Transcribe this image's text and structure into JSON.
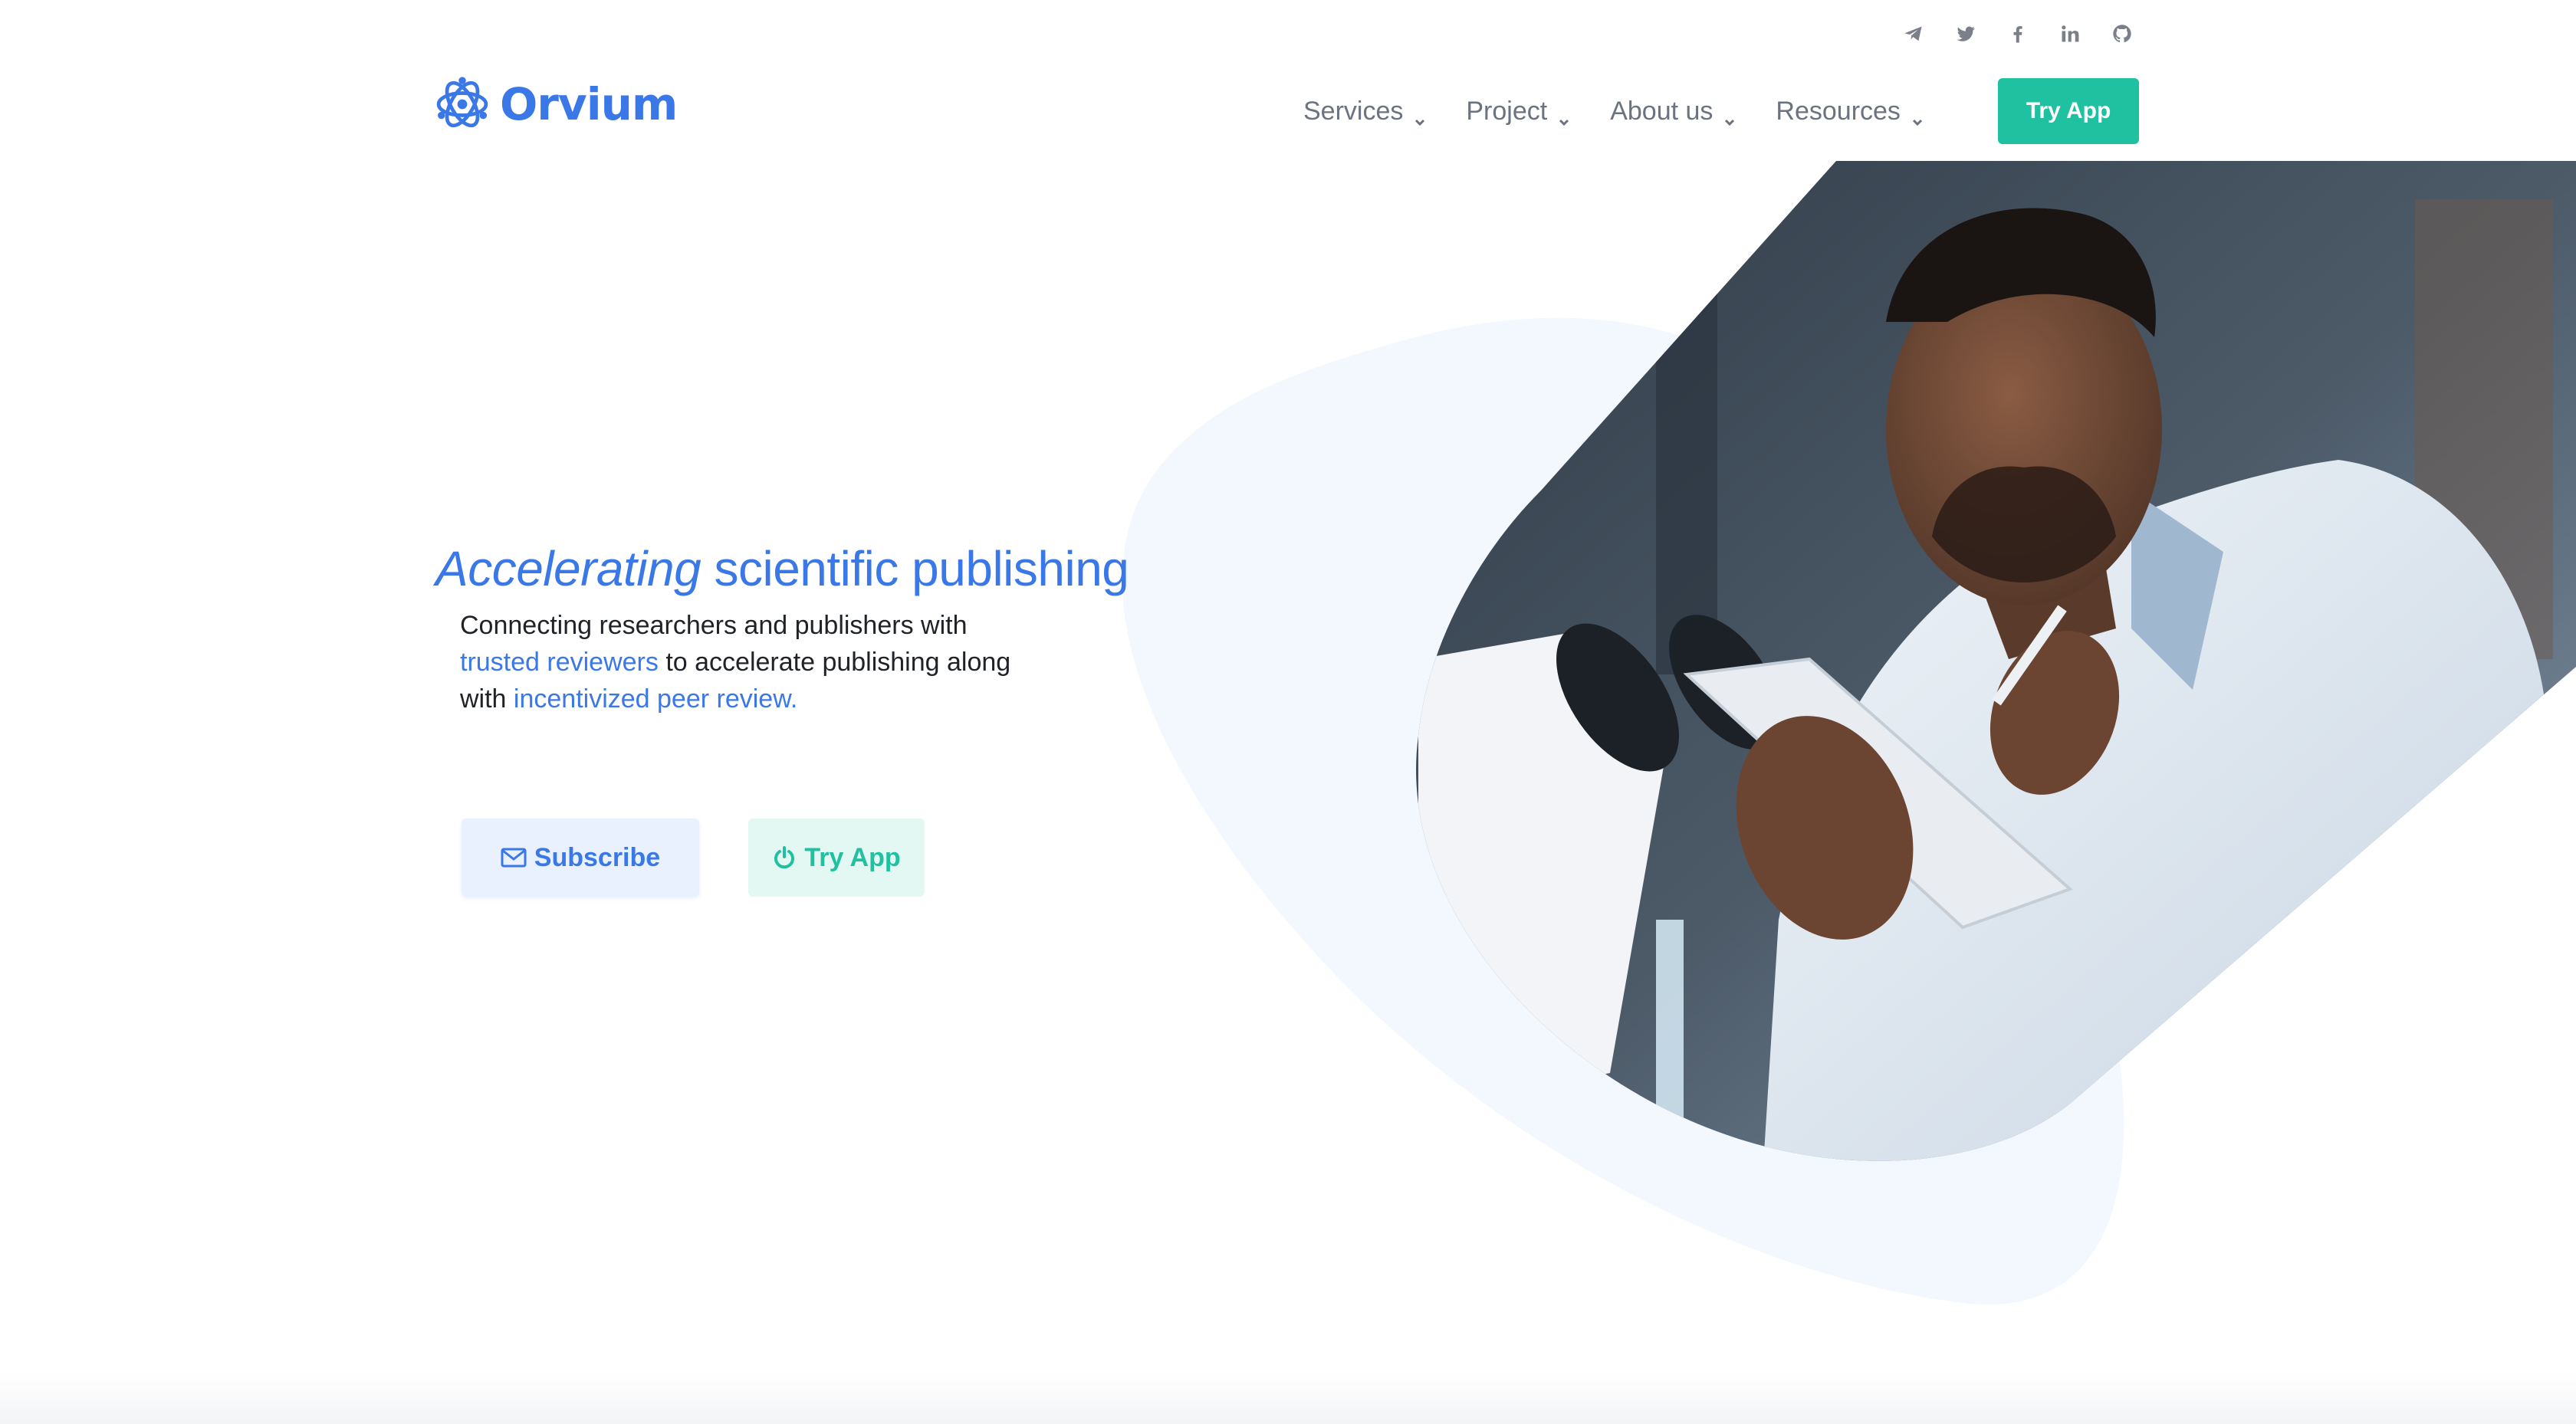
{
  "social": {
    "icons": [
      "telegram-icon",
      "twitter-icon",
      "facebook-icon",
      "linkedin-icon",
      "github-icon"
    ]
  },
  "brand": {
    "name": "Orvium",
    "color": "#3b78e7",
    "accent": "#1fc1a0"
  },
  "nav": {
    "items": [
      {
        "label": "Services"
      },
      {
        "label": "Project"
      },
      {
        "label": "About us"
      },
      {
        "label": "Resources"
      }
    ],
    "cta_label": "Try App"
  },
  "hero": {
    "headline_emphasis": "Accelerating",
    "headline_rest": " scientific publishing",
    "sub_part1": "Connecting researchers and publishers with ",
    "sub_link1": "trusted reviewers",
    "sub_part2": " to accelerate publishing along with ",
    "sub_link2": "incentivized peer review.",
    "subscribe_label": "Subscribe",
    "tryapp_label": "Try App"
  }
}
